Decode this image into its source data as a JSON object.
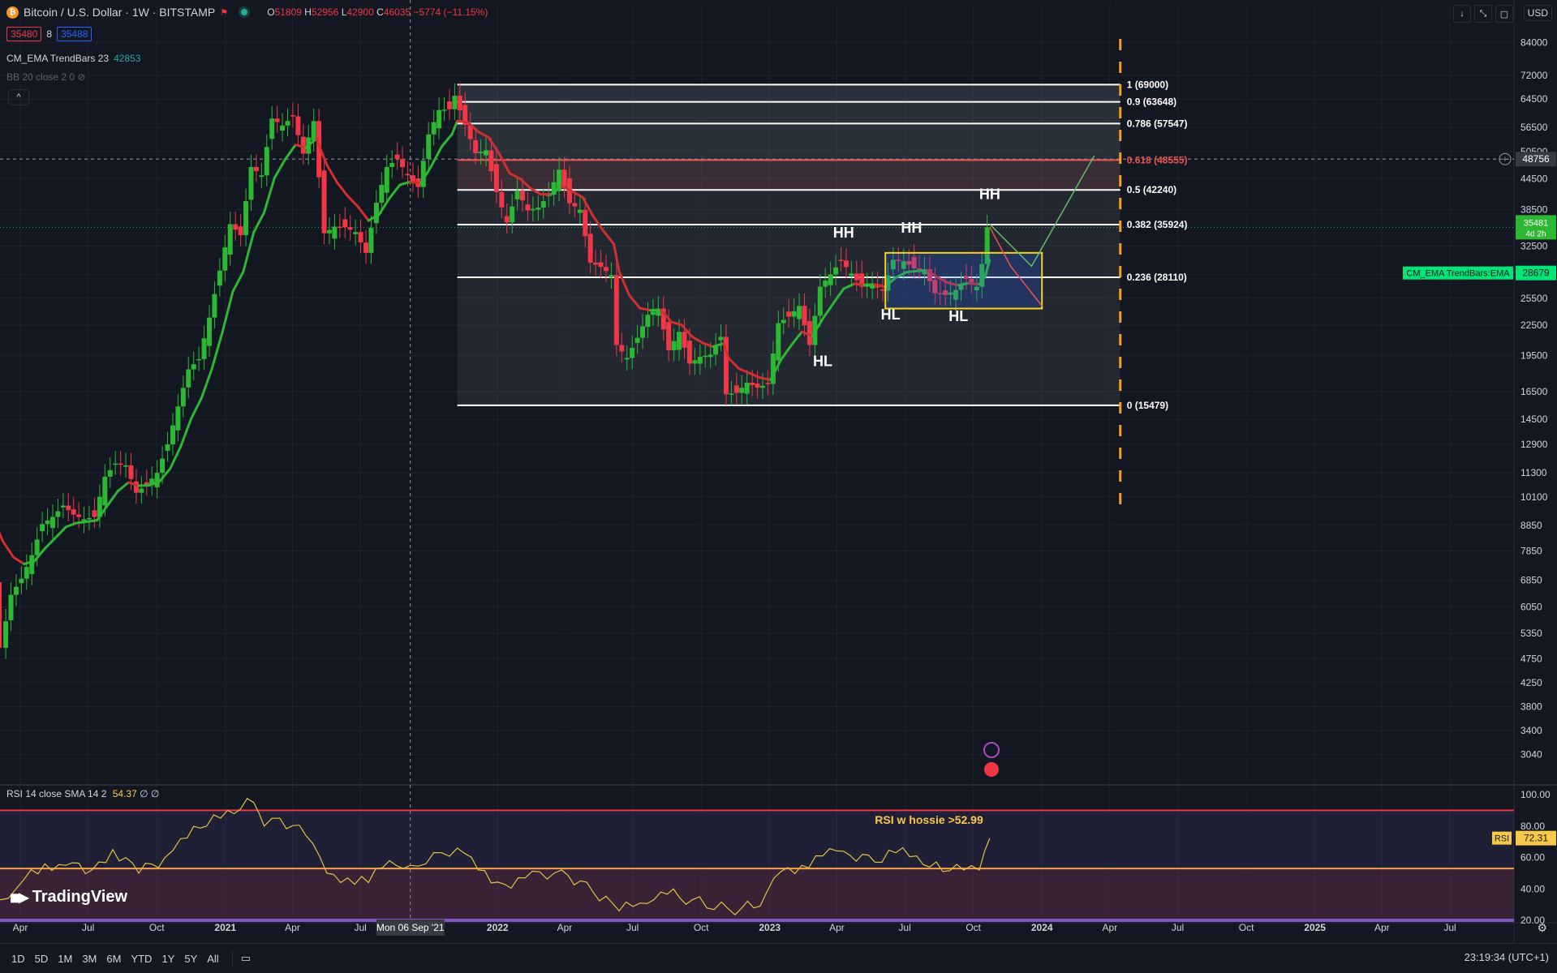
{
  "header": {
    "symbol": "Bitcoin / U.S. Dollar · 1W · BITSTAMP",
    "coin_glyph": "₿",
    "ohlc": [
      {
        "k": "O",
        "v": "51809"
      },
      {
        "k": "H",
        "v": "52956"
      },
      {
        "k": "L",
        "v": "42900"
      },
      {
        "k": "C",
        "v": "46035"
      },
      {
        "k": "",
        "v": "−5774 (−11.15%)"
      }
    ],
    "sell_price": "35480",
    "spread": "8",
    "buy_price": "35488",
    "indicator1_label": "CM_EMA TrendBars 23",
    "indicator1_value": "42853",
    "indicator2_label": "BB 20 close 2 0",
    "collapse_glyph": "^",
    "currency": "USD"
  },
  "rsi": {
    "label": "RSI 14 close SMA 14 2",
    "value": "54.37",
    "extra": "∅ ∅"
  },
  "logo": {
    "text": "TradingView",
    "mark": "◼▶"
  },
  "bottom": {
    "timeframes": [
      "1D",
      "5D",
      "1M",
      "3M",
      "6M",
      "YTD",
      "1Y",
      "5Y",
      "All"
    ],
    "clock": "23:19:34 (UTC+1)"
  },
  "chart_data": {
    "type": "candlestick",
    "symbol": "BTCUSD",
    "y_scale": "log",
    "ylim": [
      2700,
      90000
    ],
    "y_ticks": [
      84000,
      72000,
      64500,
      56500,
      50500,
      44500,
      38500,
      32500,
      28500,
      25500,
      22500,
      19500,
      16500,
      14500,
      12900,
      11300,
      10100,
      8850,
      7850,
      6850,
      6050,
      5350,
      4750,
      4250,
      3800,
      3400,
      3040
    ],
    "x_ticks": [
      {
        "label": "Apr",
        "date": "2020-04-01"
      },
      {
        "label": "Jul",
        "date": "2020-07-01"
      },
      {
        "label": "Oct",
        "date": "2020-10-01"
      },
      {
        "label": "2021",
        "date": "2021-01-01",
        "bold": true
      },
      {
        "label": "Apr",
        "date": "2021-04-01"
      },
      {
        "label": "Jul",
        "date": "2021-07-01"
      },
      {
        "label": "2022",
        "date": "2022-01-01",
        "bold": true
      },
      {
        "label": "Apr",
        "date": "2022-04-01"
      },
      {
        "label": "Jul",
        "date": "2022-07-01"
      },
      {
        "label": "Oct",
        "date": "2022-10-01"
      },
      {
        "label": "2023",
        "date": "2023-01-01",
        "bold": true
      },
      {
        "label": "Apr",
        "date": "2023-04-01"
      },
      {
        "label": "Jul",
        "date": "2023-07-01"
      },
      {
        "label": "Oct",
        "date": "2023-10-01"
      },
      {
        "label": "2024",
        "date": "2024-01-01",
        "bold": true
      },
      {
        "label": "Apr",
        "date": "2024-04-01"
      },
      {
        "label": "Jul",
        "date": "2024-07-01"
      },
      {
        "label": "Oct",
        "date": "2024-10-01"
      },
      {
        "label": "2025",
        "date": "2025-01-01",
        "bold": true
      },
      {
        "label": "Apr",
        "date": "2025-04-01"
      },
      {
        "label": "Jul",
        "date": "2025-07-01"
      }
    ],
    "crosshair": {
      "date": "2021-09-06",
      "label": "Mon 06 Sep '21"
    },
    "ema_tail": {
      "date": "2023-10-23",
      "value": 28679,
      "label": "CM_EMA TrendBars:EMA"
    },
    "last_price": {
      "value": "35481",
      "countdown": "4d 2h"
    },
    "hover_price": "48756",
    "weekly_close": [
      [
        "2020-02-17",
        9700
      ],
      [
        "2020-03-09",
        5000
      ],
      [
        "2020-03-23",
        6400
      ],
      [
        "2020-04-06",
        6900
      ],
      [
        "2020-04-20",
        7700
      ],
      [
        "2020-05-04",
        8900
      ],
      [
        "2020-05-18",
        9200
      ],
      [
        "2020-06-01",
        9700
      ],
      [
        "2020-06-15",
        9300
      ],
      [
        "2020-06-29",
        9100
      ],
      [
        "2020-07-13",
        9200
      ],
      [
        "2020-07-27",
        11100
      ],
      [
        "2020-08-10",
        11800
      ],
      [
        "2020-08-24",
        11700
      ],
      [
        "2020-09-07",
        10300
      ],
      [
        "2020-09-21",
        10700
      ],
      [
        "2020-10-05",
        11300
      ],
      [
        "2020-10-19",
        12900
      ],
      [
        "2020-11-02",
        15400
      ],
      [
        "2020-11-16",
        18300
      ],
      [
        "2020-11-30",
        19200
      ],
      [
        "2020-12-14",
        23300
      ],
      [
        "2020-12-28",
        29000
      ],
      [
        "2021-01-11",
        36000
      ],
      [
        "2021-01-25",
        34200
      ],
      [
        "2021-02-08",
        47000
      ],
      [
        "2021-02-22",
        45200
      ],
      [
        "2021-03-08",
        58900
      ],
      [
        "2021-03-22",
        57000
      ],
      [
        "2021-04-05",
        59500
      ],
      [
        "2021-04-19",
        50000
      ],
      [
        "2021-05-03",
        58200
      ],
      [
        "2021-05-17",
        34500
      ],
      [
        "2021-05-31",
        35600
      ],
      [
        "2021-06-14",
        35500
      ],
      [
        "2021-06-28",
        34700
      ],
      [
        "2021-07-12",
        31500
      ],
      [
        "2021-07-26",
        39800
      ],
      [
        "2021-08-09",
        47000
      ],
      [
        "2021-08-23",
        48800
      ],
      [
        "2021-09-06",
        45200
      ],
      [
        "2021-09-20",
        42800
      ],
      [
        "2021-10-04",
        54700
      ],
      [
        "2021-10-18",
        61300
      ],
      [
        "2021-11-01",
        61500
      ],
      [
        "2021-11-08",
        65500
      ],
      [
        "2021-11-22",
        57200
      ],
      [
        "2021-12-06",
        50100
      ],
      [
        "2021-12-20",
        50800
      ],
      [
        "2022-01-03",
        41800
      ],
      [
        "2022-01-17",
        36300
      ],
      [
        "2022-01-31",
        42100
      ],
      [
        "2022-02-14",
        38400
      ],
      [
        "2022-02-28",
        38900
      ],
      [
        "2022-03-14",
        41300
      ],
      [
        "2022-03-28",
        46400
      ],
      [
        "2022-04-11",
        39700
      ],
      [
        "2022-04-25",
        38500
      ],
      [
        "2022-05-09",
        30100
      ],
      [
        "2022-05-23",
        29500
      ],
      [
        "2022-06-06",
        28400
      ],
      [
        "2022-06-13",
        20500
      ],
      [
        "2022-06-27",
        19300
      ],
      [
        "2022-07-11",
        21200
      ],
      [
        "2022-07-25",
        23600
      ],
      [
        "2022-08-08",
        24300
      ],
      [
        "2022-08-22",
        20000
      ],
      [
        "2022-09-05",
        21800
      ],
      [
        "2022-09-19",
        18800
      ],
      [
        "2022-10-03",
        19400
      ],
      [
        "2022-10-17",
        19600
      ],
      [
        "2022-10-31",
        21300
      ],
      [
        "2022-11-07",
        16300
      ],
      [
        "2022-11-21",
        16400
      ],
      [
        "2022-12-05",
        17200
      ],
      [
        "2022-12-19",
        16800
      ],
      [
        "2023-01-02",
        17100
      ],
      [
        "2023-01-16",
        22700
      ],
      [
        "2023-01-30",
        23400
      ],
      [
        "2023-02-13",
        24600
      ],
      [
        "2023-02-27",
        20500
      ],
      [
        "2023-03-13",
        26900
      ],
      [
        "2023-03-27",
        28500
      ],
      [
        "2023-04-10",
        30400
      ],
      [
        "2023-04-24",
        28600
      ],
      [
        "2023-05-08",
        26900
      ],
      [
        "2023-05-22",
        27200
      ],
      [
        "2023-06-05",
        26400
      ],
      [
        "2023-06-19",
        30500
      ],
      [
        "2023-07-03",
        30300
      ],
      [
        "2023-07-17",
        29300
      ],
      [
        "2023-07-31",
        29200
      ],
      [
        "2023-08-14",
        26100
      ],
      [
        "2023-08-28",
        25900
      ],
      [
        "2023-09-11",
        26500
      ],
      [
        "2023-09-25",
        27900
      ],
      [
        "2023-10-09",
        26900
      ],
      [
        "2023-10-16",
        29900
      ],
      [
        "2023-10-23",
        35481
      ]
    ],
    "fibonacci": {
      "start": "2021-11-08",
      "end": "2024-04-15",
      "levels": [
        {
          "label": "1 (69000)",
          "value": 69000,
          "color": "#ffffff"
        },
        {
          "label": "0.9 (63648)",
          "value": 63648,
          "color": "#ffffff"
        },
        {
          "label": "0.786 (57547)",
          "value": 57547,
          "color": "#ffffff"
        },
        {
          "label": "0.618 (48555)",
          "value": 48555,
          "color": "#ef5350"
        },
        {
          "label": "0.5 (42240)",
          "value": 42240,
          "color": "#ffffff"
        },
        {
          "label": "0.382 (35924)",
          "value": 35924,
          "color": "#ffffff"
        },
        {
          "label": "0.236 (28110)",
          "value": 28110,
          "color": "#ffffff"
        },
        {
          "label": "0 (15479)",
          "value": 15479,
          "color": "#ffffff"
        }
      ]
    },
    "annotations": [
      {
        "text": "HH",
        "date": "2023-04-10",
        "value": 33800
      },
      {
        "text": "HH",
        "date": "2023-07-10",
        "value": 34600
      },
      {
        "text": "HH",
        "date": "2023-10-23",
        "value": 40500
      },
      {
        "text": "HL",
        "date": "2023-03-13",
        "value": 18600
      },
      {
        "text": "HL",
        "date": "2023-06-12",
        "value": 23100
      },
      {
        "text": "HL",
        "date": "2023-09-11",
        "value": 22900
      }
    ],
    "range_box": {
      "start": "2023-06-05",
      "end": "2024-01-01",
      "top": 31500,
      "bottom": 24300,
      "color": "#f7d21e"
    },
    "vertical_marker": {
      "date": "2024-04-15",
      "color": "#f59f1b"
    },
    "projection_up": [
      {
        "date": "2023-10-23",
        "value": 36000
      },
      {
        "date": "2023-12-18",
        "value": 29600
      },
      {
        "date": "2024-03-11",
        "value": 49500
      }
    ],
    "projection_down": [
      {
        "date": "2023-10-23",
        "value": 35500
      },
      {
        "date": "2023-11-20",
        "value": 29600
      },
      {
        "date": "2024-01-01",
        "value": 24600
      }
    ],
    "rsi_pane": {
      "ylim": [
        20,
        100
      ],
      "levels": [
        {
          "value": 90,
          "color": "#f23645"
        },
        {
          "value": 52.99,
          "color": "#f7a14b"
        },
        {
          "value": 20,
          "color": "#7e57c2"
        }
      ],
      "y_ticks": [
        100,
        80,
        60,
        40,
        20
      ],
      "current": "72.31",
      "note": "RSI w hossie >52.99",
      "values": [
        [
          "2020-02-17",
          38
        ],
        [
          "2020-03-16",
          34
        ],
        [
          "2020-04-06",
          46
        ],
        [
          "2020-05-04",
          56
        ],
        [
          "2020-06-01",
          55
        ],
        [
          "2020-07-06",
          52
        ],
        [
          "2020-08-03",
          65
        ],
        [
          "2020-09-07",
          50
        ],
        [
          "2020-10-12",
          60
        ],
        [
          "2020-11-02",
          72
        ],
        [
          "2020-12-07",
          80
        ],
        [
          "2021-01-04",
          90
        ],
        [
          "2021-02-08",
          95
        ],
        [
          "2021-02-22",
          80
        ],
        [
          "2021-03-15",
          85
        ],
        [
          "2021-04-19",
          74
        ],
        [
          "2021-05-17",
          50
        ],
        [
          "2021-06-14",
          47
        ],
        [
          "2021-07-12",
          44
        ],
        [
          "2021-08-09",
          58
        ],
        [
          "2021-09-06",
          55
        ],
        [
          "2021-09-27",
          56
        ],
        [
          "2021-10-18",
          63
        ],
        [
          "2021-11-08",
          66
        ],
        [
          "2021-12-06",
          52
        ],
        [
          "2022-01-10",
          43
        ],
        [
          "2022-02-07",
          47
        ],
        [
          "2022-03-28",
          52
        ],
        [
          "2022-05-09",
          38
        ],
        [
          "2022-06-13",
          26
        ],
        [
          "2022-07-11",
          31
        ],
        [
          "2022-08-08",
          38
        ],
        [
          "2022-09-19",
          33
        ],
        [
          "2022-11-07",
          27
        ],
        [
          "2022-12-19",
          29
        ],
        [
          "2023-01-16",
          51
        ],
        [
          "2023-02-13",
          55
        ],
        [
          "2023-03-13",
          61
        ],
        [
          "2023-04-10",
          64
        ],
        [
          "2023-05-22",
          57
        ],
        [
          "2023-06-19",
          63
        ],
        [
          "2023-07-17",
          61
        ],
        [
          "2023-08-21",
          51
        ],
        [
          "2023-09-18",
          52
        ],
        [
          "2023-10-09",
          52
        ],
        [
          "2023-10-16",
          64
        ],
        [
          "2023-10-23",
          72.31
        ]
      ]
    }
  }
}
